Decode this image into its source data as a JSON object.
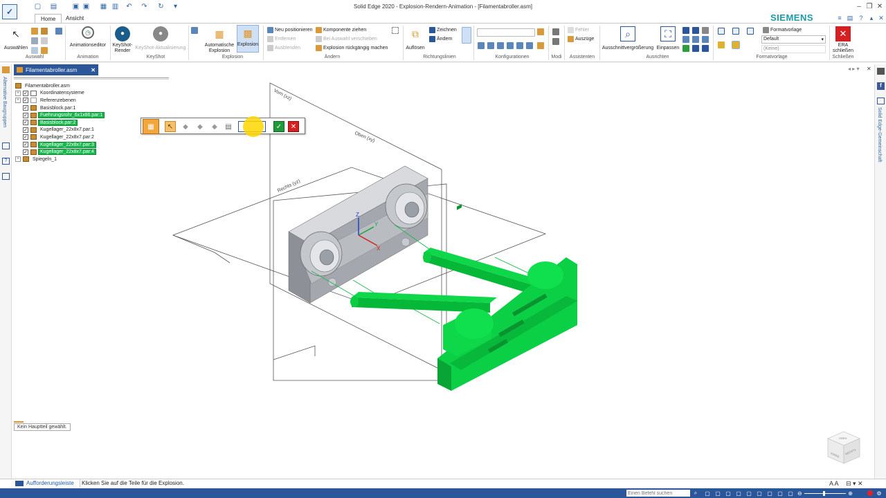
{
  "window": {
    "title": "Solid Edge 2020 - Explosion-Rendern-Animation - [Filamentabroller.asm]",
    "brand": "SIEMENS"
  },
  "tabs": [
    {
      "label": "Home"
    },
    {
      "label": "Ansicht"
    }
  ],
  "ribbon": {
    "groups": {
      "auswahl": "Auswahl",
      "animation": "Animation",
      "keyshot": "KeyShot",
      "explosion": "Explosion",
      "aendern": "Ändern",
      "richtungslinien": "Richtungslinien",
      "konfigurationen": "Konfigurationen",
      "modi": "Modi",
      "assistenten": "Assistenten",
      "ausrichten": "Ausrichten",
      "formatvorlage": "Formatvorlage",
      "schliessen": "Schließen"
    },
    "buttons": {
      "auswaehlen": "Auswählen",
      "animationseditor": "Animationseditor",
      "keyshot_render_1": "KeyShot-",
      "keyshot_render_2": "Render",
      "keyshot_update": "KeyShot-Aktualisierung",
      "auto_explosion_1": "Automatische",
      "auto_explosion_2": "Explosion",
      "explosion": "Explosion",
      "neu_positionieren": "Neu positionieren",
      "entfernen": "Entfernen",
      "ausblenden": "Ausblenden",
      "komponente_ziehen": "Komponente ziehen",
      "bei_auswahl": "Bei Auswahl verschieben",
      "rueckgaengig": "Explosion rückgängig machen",
      "aufloesen": "Auflösen",
      "zeichnen": "Zeichnen",
      "aendern_btn": "Ändern",
      "fehler": "Fehler",
      "auszuege": "Auszüge",
      "ausschnitt": "Ausschnittvergrößerung",
      "einpassen": "Einpassen",
      "formatvorlage_label": "Formatvorlage",
      "formatvorlage_value": "Default",
      "formatvorlage_second": "(Keine)",
      "era_1": "ERA",
      "era_2": "schließen"
    }
  },
  "document_tab": {
    "label": "Filamentabroller.asm"
  },
  "left_panel": {
    "vertical_label": "Alternative Baugruppen"
  },
  "right_panel": {
    "vertical_label": "Solid Edge-Gemeinschaft"
  },
  "tree": {
    "root": "Filamentabroller.asm",
    "items": [
      {
        "label": "Koordinatensysteme",
        "selected": false,
        "expander": "+"
      },
      {
        "label": "Referenzebenen",
        "selected": false,
        "expander": "+"
      },
      {
        "label": "Basisblock.par:1",
        "selected": false,
        "expander": ""
      },
      {
        "label": "Fuehrungsrohr_6x1x86.par:1",
        "selected": true,
        "expander": ""
      },
      {
        "label": "Basisblock.par:2",
        "selected": true,
        "expander": ""
      },
      {
        "label": "Kugellager_22x8x7.par:1",
        "selected": false,
        "expander": ""
      },
      {
        "label": "Kugellager_22x8x7.par:2",
        "selected": false,
        "expander": ""
      },
      {
        "label": "Kugellager_22x8x7.par:3",
        "selected": true,
        "expander": ""
      },
      {
        "label": "Kugellager_22x8x7.par:4",
        "selected": true,
        "expander": ""
      },
      {
        "label": "Spiegeln_1",
        "selected": false,
        "expander": "+"
      }
    ],
    "no_main_part": "Kein Hauptteil gewählt."
  },
  "viewport": {
    "planes": {
      "front": "Vorn (xz)",
      "top": "Oben (xy)",
      "right": "Rechts (yz)"
    },
    "axes": {
      "x": "X",
      "y": "Y",
      "z": "Z"
    },
    "viewcube": {
      "top": "OBEN",
      "front": "VORNE",
      "right": "RECHTS"
    }
  },
  "statusbar": {
    "prompt_label": "Aufforderungsleiste",
    "prompt_text": "Klicken Sie auf die Teile für die Explosion.",
    "command_placeholder": "Einen Befehl suchen"
  },
  "colors": {
    "accent": "#2b579a",
    "selection": "#18b84d",
    "siemens": "#1a9ba8"
  }
}
